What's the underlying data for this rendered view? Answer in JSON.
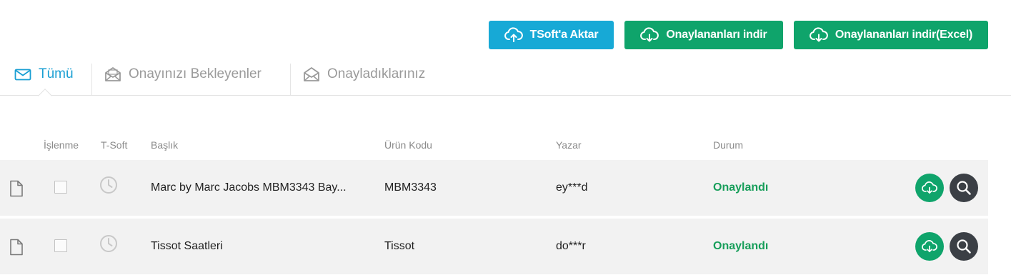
{
  "toolbar": {
    "tsoft_export_label": "TSoft'a Aktar",
    "download_approved_label": "Onaylananları indir",
    "download_approved_excel_label": "Onaylananları indir(Excel)"
  },
  "tabs": [
    {
      "label": "Tümü",
      "active": true
    },
    {
      "label": "Onayınızı Bekleyenler",
      "active": false
    },
    {
      "label": "Onayladıklarınız",
      "active": false
    }
  ],
  "table": {
    "headers": {
      "islenme": "İşlenme",
      "tsoft": "T-Soft",
      "baslik": "Başlık",
      "urun_kodu": "Ürün Kodu",
      "yazar": "Yazar",
      "durum": "Durum"
    },
    "rows": [
      {
        "baslik": "Marc by Marc Jacobs MBM3343 Bay...",
        "urun_kodu": "MBM3343",
        "yazar": "ey***d",
        "durum": "Onaylandı"
      },
      {
        "baslik": "Tissot Saatleri",
        "urun_kodu": "Tissot",
        "yazar": "do***r",
        "durum": "Onaylandı"
      }
    ]
  },
  "colors": {
    "accent_blue": "#17a9d6",
    "accent_green": "#0fa46b",
    "status_green": "#179e5a",
    "dark_button": "#3b3f45"
  },
  "icons": {
    "upload": "cloud-upload-icon",
    "download": "cloud-download-icon",
    "mail": "envelope-icon",
    "open_mail": "envelope-open-icon",
    "document": "document-icon",
    "clock": "clock-icon",
    "search": "search-icon"
  }
}
